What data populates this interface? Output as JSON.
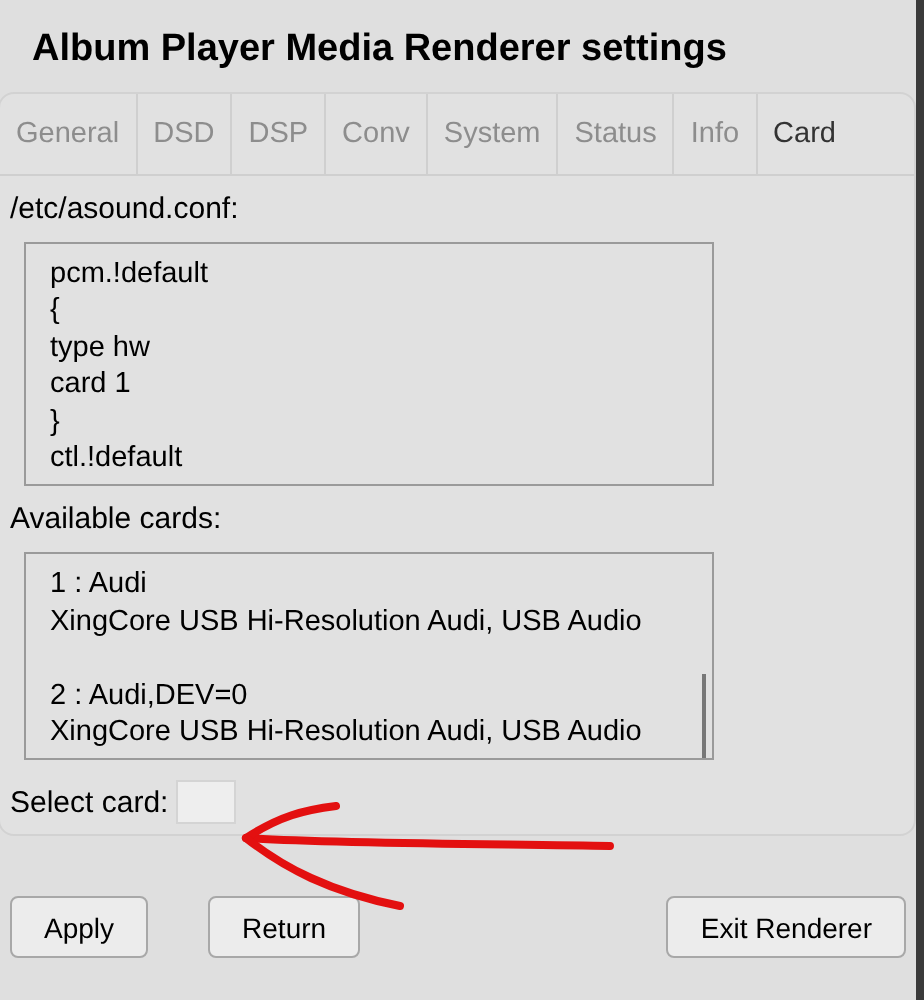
{
  "window": {
    "title": "Album Player Media Renderer settings"
  },
  "tabs": [
    {
      "label": "General",
      "selected": false
    },
    {
      "label": "DSD",
      "selected": false
    },
    {
      "label": "DSP",
      "selected": false
    },
    {
      "label": "Conv",
      "selected": false
    },
    {
      "label": "System",
      "selected": false
    },
    {
      "label": "Status",
      "selected": false
    },
    {
      "label": "Info",
      "selected": false
    },
    {
      "label": "Card",
      "selected": true
    }
  ],
  "config": {
    "label": "/etc/asound.conf:",
    "lines": [
      "pcm.!default",
      "{",
      "type hw",
      "card 1",
      "}",
      "ctl.!default"
    ]
  },
  "cards": {
    "label": "Available cards:",
    "entries": [
      {
        "id": "1 : Audi",
        "description": "XingCore USB Hi-Resolution Audi, USB Audio"
      },
      {
        "id": "2 : Audi,DEV=0",
        "description": "XingCore USB Hi-Resolution Audi, USB Audio"
      }
    ]
  },
  "select_card": {
    "label": "Select card:"
  },
  "buttons": [
    "Apply",
    "Return",
    "Exit Renderer"
  ]
}
